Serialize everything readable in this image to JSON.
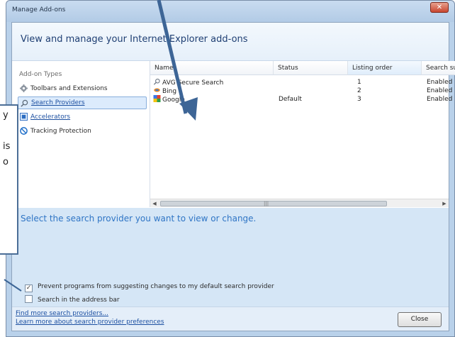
{
  "window": {
    "title": "Manage Add-ons",
    "close_glyph": "✕"
  },
  "header": {
    "heading": "View and manage your Internet Explorer add-ons"
  },
  "addon_types": {
    "title": "Add-on Types",
    "items": [
      {
        "label": "Toolbars and Extensions",
        "icon": "gear-icon",
        "selected": false
      },
      {
        "label": "Search Providers",
        "icon": "search-icon",
        "selected": true
      },
      {
        "label": "Accelerators",
        "icon": "accelerator-icon",
        "selected": false
      },
      {
        "label": "Tracking Protection",
        "icon": "no-entry-icon",
        "selected": false
      }
    ]
  },
  "list": {
    "columns": [
      "Name",
      "Status",
      "Listing order",
      "Search sug"
    ],
    "rows": [
      {
        "name": "AVG Secure Search",
        "icon": "magnifier-icon",
        "status": "",
        "order": "1",
        "suggestions": "Enabled"
      },
      {
        "name": "Bing",
        "icon": "bing-icon",
        "status": "",
        "order": "2",
        "suggestions": "Enabled"
      },
      {
        "name": "Google",
        "icon": "google-icon",
        "status": "Default",
        "order": "3",
        "suggestions": "Enabled"
      }
    ],
    "scrollbar": {
      "left": "◀",
      "right": "▶",
      "grip": "|||"
    }
  },
  "details": {
    "message": "Select the search provider you want to view or change.",
    "checkbox_prevent": {
      "label": "Prevent programs from suggesting changes to my default search provider",
      "checked": true,
      "mark": "✓"
    },
    "checkbox_address": {
      "label": "Search in the address bar",
      "checked": false,
      "mark": ""
    }
  },
  "footer": {
    "find_more": "Find more search providers...",
    "learn_more": "Learn more about search provider preferences",
    "close_button": "Close"
  },
  "callout": {
    "lines": [
      "y",
      "",
      "is",
      "o"
    ]
  },
  "colors": {
    "accent": "#2f75c5",
    "arrow": "#3d6596",
    "frame": "#b9d1ea"
  }
}
